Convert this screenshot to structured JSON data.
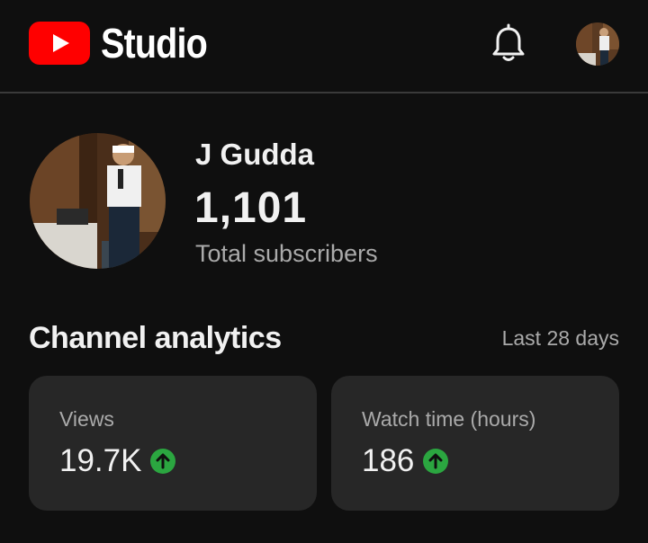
{
  "header": {
    "brand_icon": "youtube-play-logo",
    "brand_text": "Studio",
    "notifications_icon": "bell-icon",
    "account_icon": "profile-avatar"
  },
  "channel": {
    "name": "J Gudda",
    "subscriber_count": "1,101",
    "subscriber_label": "Total subscribers",
    "avatar_icon": "channel-avatar"
  },
  "analytics": {
    "title": "Channel analytics",
    "period": "Last 28 days",
    "cards": [
      {
        "label": "Views",
        "value": "19.7K",
        "trend_icon": "arrow-up-icon",
        "trend_color": "#2ba640"
      },
      {
        "label": "Watch time (hours)",
        "value": "186",
        "trend_icon": "arrow-up-icon",
        "trend_color": "#2ba640"
      }
    ]
  },
  "colors": {
    "background": "#0f0f0f",
    "brand_red": "#ff0000",
    "card_bg": "#272727",
    "secondary_text": "#aaaaaa"
  }
}
